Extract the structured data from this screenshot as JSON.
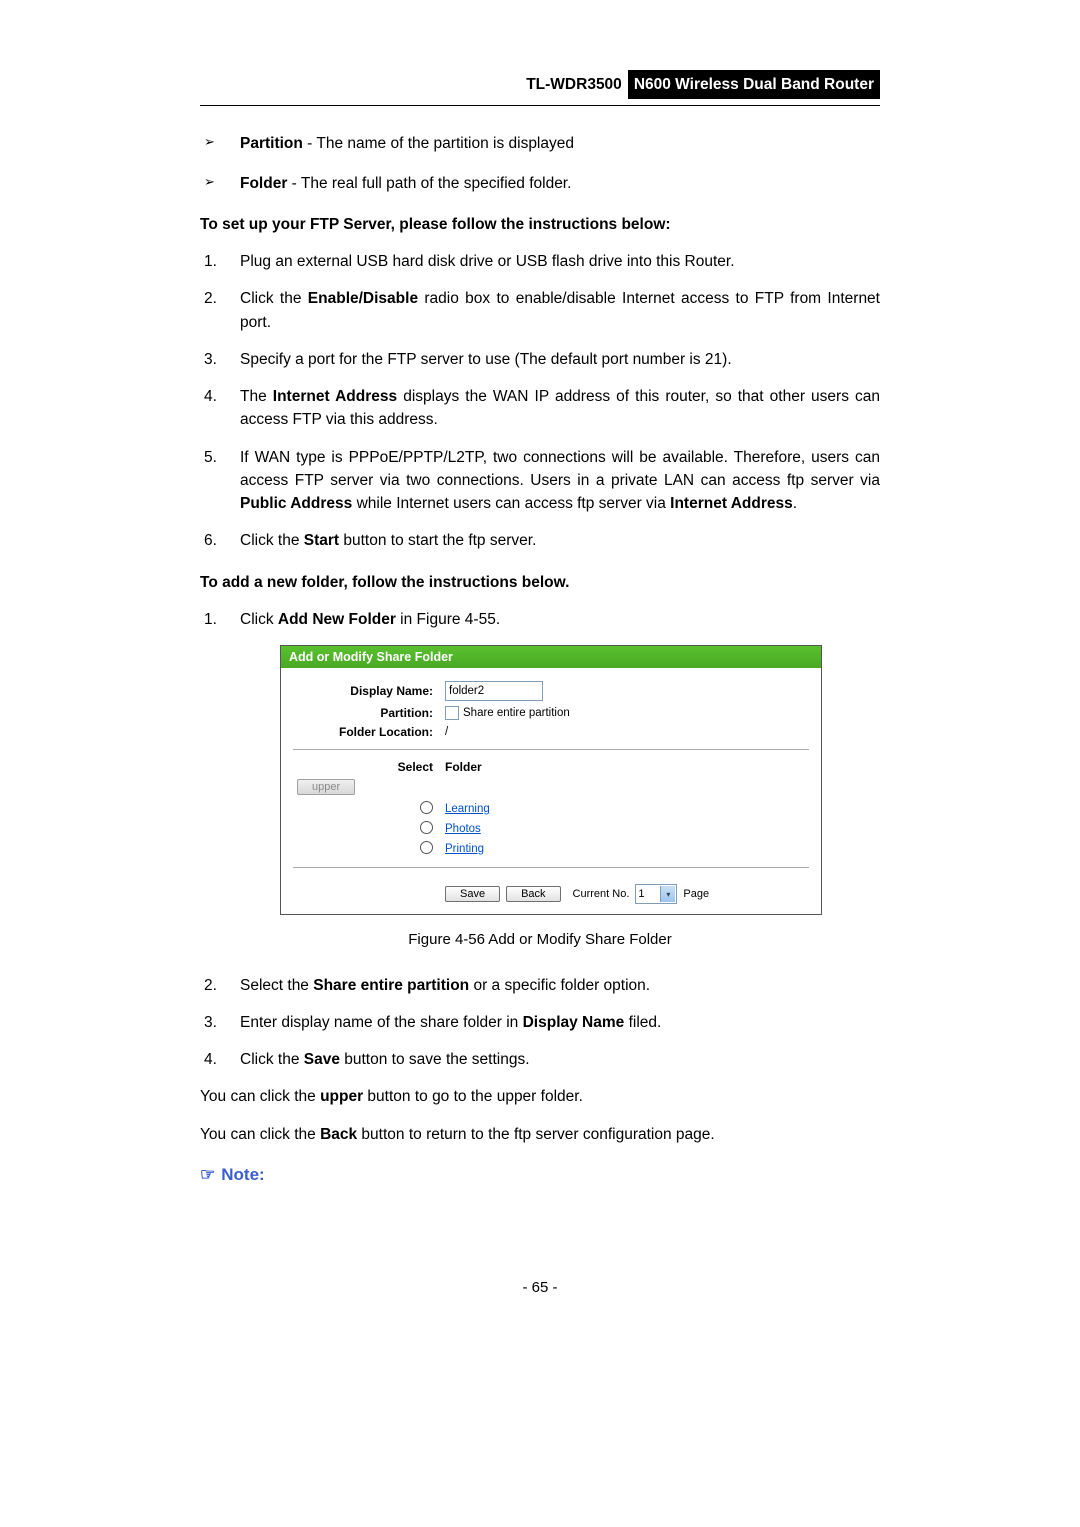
{
  "header": {
    "model": "TL-WDR3500",
    "product": "N600 Wireless Dual Band Router"
  },
  "definitions": [
    {
      "term": "Partition",
      "desc": " - The name of the partition is displayed"
    },
    {
      "term": "Folder",
      "desc": " - The real full path of the specified folder."
    }
  ],
  "ftp_setup_heading": "To set up your FTP Server, please follow the instructions below:",
  "ftp_steps": {
    "s1": "Plug an external USB hard disk drive or USB flash drive into this Router.",
    "s2a": "Click the ",
    "s2b": "Enable/Disable",
    "s2c": " radio box to enable/disable Internet access to FTP from Internet port.",
    "s3": "Specify a port for the FTP server to use (The default port number is 21).",
    "s4a": "The ",
    "s4b": "Internet Address",
    "s4c": " displays the WAN IP address of this router, so that other users can access FTP via this address.",
    "s5a": "If WAN type is PPPoE/PPTP/L2TP, two connections will be available. Therefore, users can access FTP server via two connections. Users in a private LAN can access ftp server via ",
    "s5b": "Public Address",
    "s5c": " while Internet users can access ftp server via ",
    "s5d": "Internet Address",
    "s5e": ".",
    "s6a": "Click the ",
    "s6b": "Start",
    "s6c": " button to start the ftp server."
  },
  "add_folder_heading": "To add a new folder, follow the instructions below.",
  "add_steps": {
    "a1a": "Click ",
    "a1b": "Add New Folder",
    "a1c": " in Figure 4-55."
  },
  "figure": {
    "title": "Add or Modify Share Folder",
    "labels": {
      "display_name": "Display Name:",
      "partition": "Partition:",
      "folder_location": "Folder Location:",
      "select": "Select",
      "folder": "Folder"
    },
    "values": {
      "display_name": "folder2",
      "share_entire": "Share entire partition",
      "folder_location": "/"
    },
    "upper_btn": "upper",
    "folders": [
      "Learning",
      "Photos",
      "Printing"
    ],
    "buttons": {
      "save": "Save",
      "back": "Back"
    },
    "current_no_label": "Current No.",
    "current_no_value": "1",
    "page_label": "Page"
  },
  "caption": "Figure 4-56 Add or Modify Share Folder",
  "post_steps": {
    "p2a": "Select the ",
    "p2b": "Share entire partition",
    "p2c": " or a specific folder option.",
    "p3a": "Enter display name of the share folder in ",
    "p3b": "Display Name",
    "p3c": " filed.",
    "p4a": "Click the ",
    "p4b": "Save",
    "p4c": " button to save the settings."
  },
  "upper_line": {
    "a": "You can click the ",
    "b": "upper",
    "c": " button to go to the upper folder."
  },
  "back_line": {
    "a": "You can click the ",
    "b": "Back",
    "c": " button to return to the ftp server configuration page."
  },
  "note_label": "Note:",
  "page_number": "- 65 -"
}
